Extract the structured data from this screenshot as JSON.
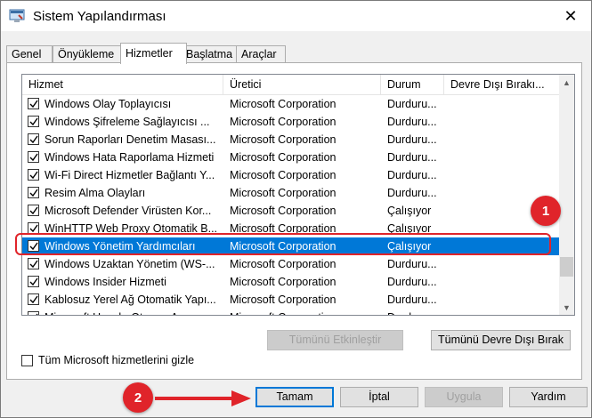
{
  "window": {
    "title": "Sistem Yapılandırması",
    "close_glyph": "✕"
  },
  "tabs": [
    {
      "label": "Genel",
      "active": false
    },
    {
      "label": "Önyükleme",
      "active": false
    },
    {
      "label": "Hizmetler",
      "active": true
    },
    {
      "label": "Başlatma",
      "active": false
    },
    {
      "label": "Araçlar",
      "active": false
    }
  ],
  "services_table": {
    "columns": [
      "Hizmet",
      "Üretici",
      "Durum",
      "Devre Dışı Bırakı..."
    ],
    "rows": [
      {
        "service": "Windows Olay Toplayıcısı",
        "maker": "Microsoft Corporation",
        "status": "Durduru...",
        "checked": true,
        "selected": false
      },
      {
        "service": "Windows Şifreleme Sağlayıcısı ...",
        "maker": "Microsoft Corporation",
        "status": "Durduru...",
        "checked": true,
        "selected": false
      },
      {
        "service": "Sorun Raporları Denetim Masası...",
        "maker": "Microsoft Corporation",
        "status": "Durduru...",
        "checked": true,
        "selected": false
      },
      {
        "service": "Windows Hata Raporlama Hizmeti",
        "maker": "Microsoft Corporation",
        "status": "Durduru...",
        "checked": true,
        "selected": false
      },
      {
        "service": "Wi-Fi Direct Hizmetler Bağlantı Y...",
        "maker": "Microsoft Corporation",
        "status": "Durduru...",
        "checked": true,
        "selected": false
      },
      {
        "service": "Resim Alma Olayları",
        "maker": "Microsoft Corporation",
        "status": "Durduru...",
        "checked": true,
        "selected": false
      },
      {
        "service": "Microsoft Defender Virüsten Kor...",
        "maker": "Microsoft Corporation",
        "status": "Çalışıyor",
        "checked": true,
        "selected": false
      },
      {
        "service": "WinHTTP Web Proxy Otomatik B...",
        "maker": "Microsoft Corporation",
        "status": "Çalışıyor",
        "checked": true,
        "selected": false
      },
      {
        "service": "Windows Yönetim Yardımcıları",
        "maker": "Microsoft Corporation",
        "status": "Çalışıyor",
        "checked": true,
        "selected": true
      },
      {
        "service": "Windows Uzaktan Yönetim (WS-...",
        "maker": "Microsoft Corporation",
        "status": "Durduru...",
        "checked": true,
        "selected": false
      },
      {
        "service": "Windows Insider Hizmeti",
        "maker": "Microsoft Corporation",
        "status": "Durduru...",
        "checked": true,
        "selected": false
      },
      {
        "service": "Kablosuz Yerel Ağ Otomatik Yapı...",
        "maker": "Microsoft Corporation",
        "status": "Durduru...",
        "checked": true,
        "selected": false
      },
      {
        "service": "Microsoft Hesabı Oturum Açma ...",
        "maker": "Microsoft Corporation",
        "status": "Durduru...",
        "checked": true,
        "selected": false
      }
    ]
  },
  "buttons": {
    "enable_all": "Tümünü Etkinleştir",
    "disable_all": "Tümünü Devre Dışı Bırak",
    "ok": "Tamam",
    "cancel": "İptal",
    "apply": "Uygula",
    "help": "Yardım"
  },
  "hide_ms_checkbox": {
    "label": "Tüm Microsoft hizmetlerini gizle",
    "checked": false
  },
  "annotations": {
    "badge_1": "1",
    "badge_2": "2",
    "accent_color": "#e0242a"
  },
  "colors": {
    "selection": "#0078d7"
  }
}
